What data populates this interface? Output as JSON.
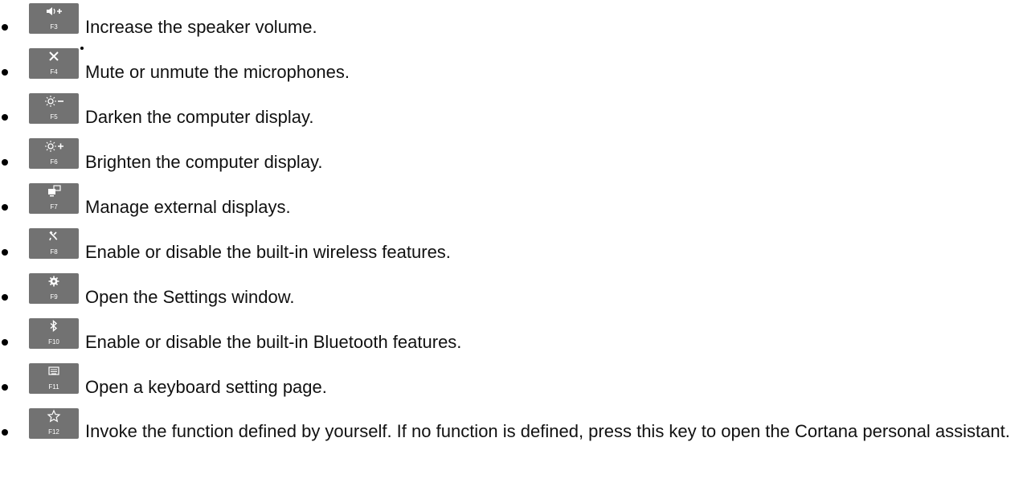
{
  "items": [
    {
      "key": "F3",
      "icon": "speaker-volume-up-icon",
      "glyph": "🔊+",
      "text": "Increase the speaker volume."
    },
    {
      "key": "F4",
      "icon": "microphone-mute-icon",
      "glyph": "✕",
      "text": "Mute or unmute the microphones."
    },
    {
      "key": "F5",
      "icon": "brightness-down-icon",
      "glyph": "☼−",
      "text": "Darken the computer display."
    },
    {
      "key": "F6",
      "icon": "brightness-up-icon",
      "glyph": "☼+",
      "text": "Brighten the computer display."
    },
    {
      "key": "F7",
      "icon": "external-display-icon",
      "glyph": "⧉",
      "text": "Manage external displays."
    },
    {
      "key": "F8",
      "icon": "airplane-mode-icon",
      "glyph": "✈",
      "text": "Enable or disable the built-in wireless features."
    },
    {
      "key": "F9",
      "icon": "settings-gear-icon",
      "glyph": "⚙",
      "text": "Open the Settings window."
    },
    {
      "key": "F10",
      "icon": "bluetooth-icon",
      "glyph": "ᛒ",
      "text": "Enable or disable the built-in Bluetooth features."
    },
    {
      "key": "F11",
      "icon": "keyboard-icon",
      "glyph": "⌨",
      "text": "Open a keyboard setting page."
    },
    {
      "key": "F12",
      "icon": "star-icon",
      "glyph": "☆",
      "text": "Invoke the function defined by yourself. If no function is defined, press this key to open the Cortana personal assistant."
    }
  ],
  "colors": {
    "keycap": "#727272",
    "text": "#111111"
  }
}
